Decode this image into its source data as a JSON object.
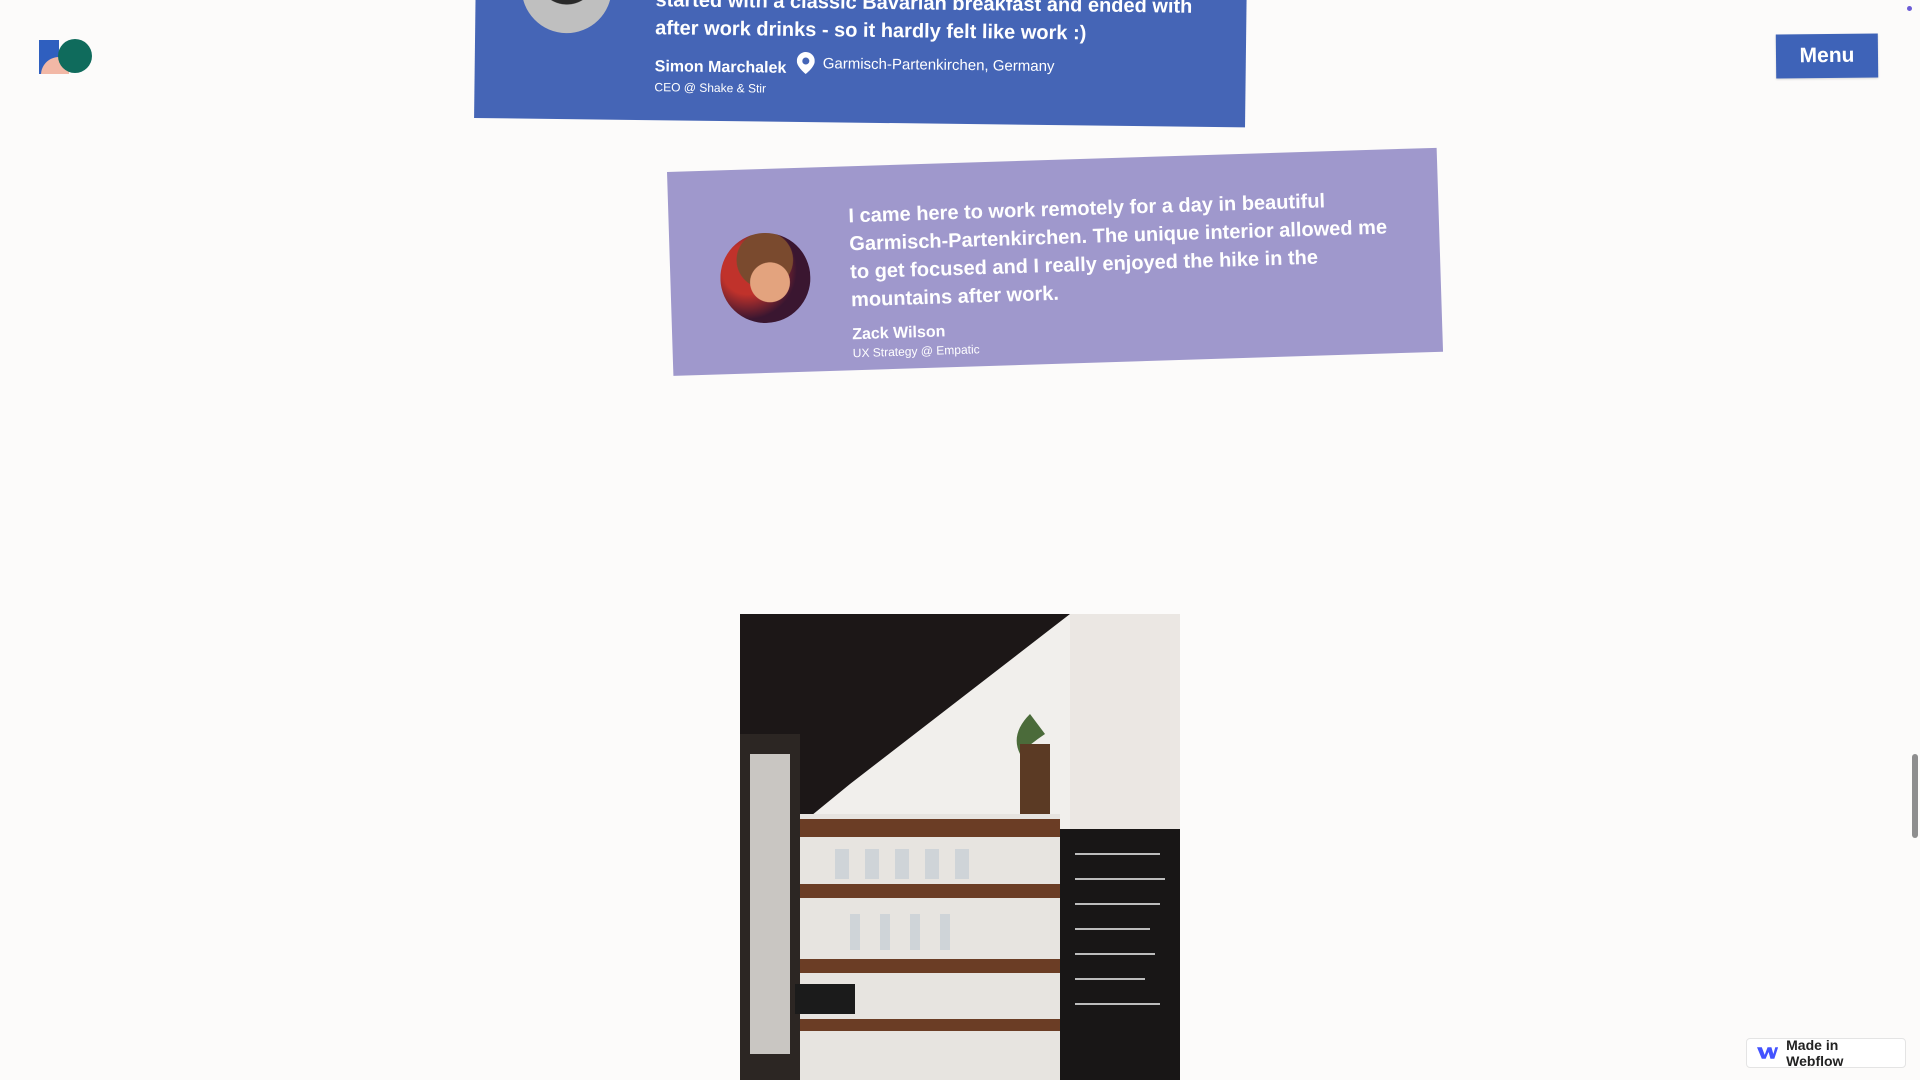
{
  "header": {
    "logo": "site-logo",
    "menu_label": "Menu"
  },
  "testimonials": [
    {
      "quote": "started with a classic Bavarian breakfast and ended with after work drinks - so it hardly felt like work :)",
      "name": "Simon Marchalek",
      "role": "CEO @ Shake & Stir",
      "location": "Garmisch-Partenkirchen, Germany",
      "color": "#4565b6"
    },
    {
      "quote": "I came here to work remotely for a day in beautiful Garmisch-Partenkirchen. The unique interior allowed me to get focused and I really enjoyed the hike in the mountains after work.",
      "name": "Zack Wilson",
      "role": "UX Strategy @ Empatic",
      "color": "#9f98cc"
    }
  ],
  "photo": {
    "icon": "cafe-shelves-photo"
  },
  "badge": {
    "label": "Made in Webflow"
  }
}
